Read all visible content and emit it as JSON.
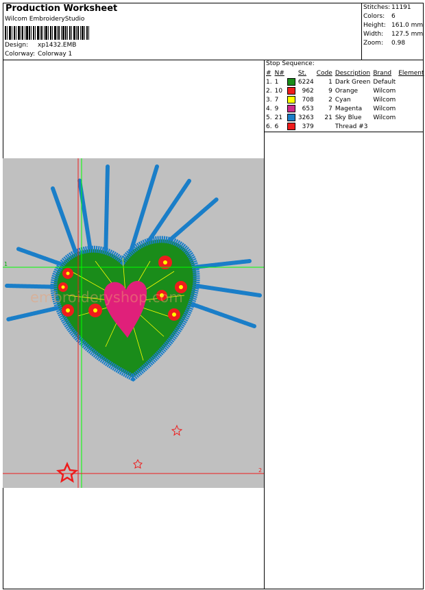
{
  "header": {
    "title": "Production Worksheet",
    "subtitle": "Wilcom EmbroideryStudio",
    "design_label": "Design:",
    "design_value": "xp1432.EMB",
    "colorway_label": "Colorway:",
    "colorway_value": "Colorway 1"
  },
  "stats": {
    "stitches_label": "Stitches:",
    "stitches": "11191",
    "colors_label": "Colors:",
    "colors": "6",
    "height_label": "Height:",
    "height": "161.0 mm",
    "width_label": "Width:",
    "width": "127.5 mm",
    "zoom_label": "Zoom:",
    "zoom": "0.98"
  },
  "stop_sequence": {
    "title": "Stop Sequence:",
    "headers": [
      "#",
      "N#",
      "St.",
      "Code",
      "Description",
      "Brand",
      "Element"
    ],
    "rows": [
      {
        "num": "1.",
        "n": "1",
        "color": "#1a8c1a",
        "st": "6224",
        "code": "1",
        "desc": "Dark Green",
        "brand": "Default"
      },
      {
        "num": "2.",
        "n": "10",
        "color": "#ee1c1c",
        "st": "962",
        "code": "9",
        "desc": "Orange",
        "brand": "Wilcom"
      },
      {
        "num": "3.",
        "n": "7",
        "color": "#ffff00",
        "st": "708",
        "code": "2",
        "desc": "Cyan",
        "brand": "Wilcom"
      },
      {
        "num": "4.",
        "n": "9",
        "color": "#cc2a8a",
        "st": "653",
        "code": "7",
        "desc": "Magenta",
        "brand": "Wilcom"
      },
      {
        "num": "5.",
        "n": "21",
        "color": "#1a7ec8",
        "st": "3263",
        "code": "21",
        "desc": "Sky Blue",
        "brand": "Wilcom"
      },
      {
        "num": "6.",
        "n": "6",
        "color": "#ee1c1c",
        "st": "379",
        "code": "",
        "desc": "Thread #3",
        "brand": ""
      }
    ]
  },
  "canvas": {
    "background": "#c0c0c0",
    "marker_1": "1",
    "marker_2": "2",
    "watermark": "embroideryshop.com"
  }
}
